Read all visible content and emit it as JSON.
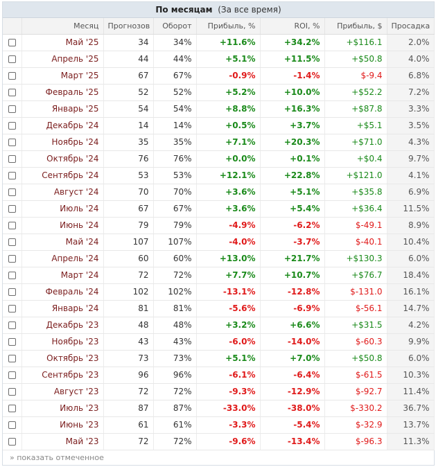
{
  "caption": {
    "title": "По месяцам",
    "subtitle": "(За все время)"
  },
  "columns": [
    "Месяц",
    "Прогнозов",
    "Оборот",
    "Прибыль, %",
    "ROI, %",
    "Прибыль, $",
    "Просадка"
  ],
  "rows": [
    {
      "month": "Май '25",
      "forecasts": "34",
      "turnover": "34%",
      "profit_pct": "+11.6%",
      "roi": "+34.2%",
      "profit_usd": "+$116.1",
      "drawdown": "2.0%"
    },
    {
      "month": "Апрель '25",
      "forecasts": "44",
      "turnover": "44%",
      "profit_pct": "+5.1%",
      "roi": "+11.5%",
      "profit_usd": "+$50.8",
      "drawdown": "4.0%"
    },
    {
      "month": "Март '25",
      "forecasts": "67",
      "turnover": "67%",
      "profit_pct": "-0.9%",
      "roi": "-1.4%",
      "profit_usd": "$-9.4",
      "drawdown": "6.8%"
    },
    {
      "month": "Февраль '25",
      "forecasts": "52",
      "turnover": "52%",
      "profit_pct": "+5.2%",
      "roi": "+10.0%",
      "profit_usd": "+$52.2",
      "drawdown": "7.2%"
    },
    {
      "month": "Январь '25",
      "forecasts": "54",
      "turnover": "54%",
      "profit_pct": "+8.8%",
      "roi": "+16.3%",
      "profit_usd": "+$87.8",
      "drawdown": "3.3%"
    },
    {
      "month": "Декабрь '24",
      "forecasts": "14",
      "turnover": "14%",
      "profit_pct": "+0.5%",
      "roi": "+3.7%",
      "profit_usd": "+$5.1",
      "drawdown": "3.5%"
    },
    {
      "month": "Ноябрь '24",
      "forecasts": "35",
      "turnover": "35%",
      "profit_pct": "+7.1%",
      "roi": "+20.3%",
      "profit_usd": "+$71.0",
      "drawdown": "4.3%"
    },
    {
      "month": "Октябрь '24",
      "forecasts": "76",
      "turnover": "76%",
      "profit_pct": "+0.0%",
      "roi": "+0.1%",
      "profit_usd": "+$0.4",
      "drawdown": "9.7%"
    },
    {
      "month": "Сентябрь '24",
      "forecasts": "53",
      "turnover": "53%",
      "profit_pct": "+12.1%",
      "roi": "+22.8%",
      "profit_usd": "+$121.0",
      "drawdown": "4.1%"
    },
    {
      "month": "Август '24",
      "forecasts": "70",
      "turnover": "70%",
      "profit_pct": "+3.6%",
      "roi": "+5.1%",
      "profit_usd": "+$35.8",
      "drawdown": "6.9%"
    },
    {
      "month": "Июль '24",
      "forecasts": "67",
      "turnover": "67%",
      "profit_pct": "+3.6%",
      "roi": "+5.4%",
      "profit_usd": "+$36.4",
      "drawdown": "11.5%"
    },
    {
      "month": "Июнь '24",
      "forecasts": "79",
      "turnover": "79%",
      "profit_pct": "-4.9%",
      "roi": "-6.2%",
      "profit_usd": "$-49.1",
      "drawdown": "8.9%"
    },
    {
      "month": "Май '24",
      "forecasts": "107",
      "turnover": "107%",
      "profit_pct": "-4.0%",
      "roi": "-3.7%",
      "profit_usd": "$-40.1",
      "drawdown": "10.4%"
    },
    {
      "month": "Апрель '24",
      "forecasts": "60",
      "turnover": "60%",
      "profit_pct": "+13.0%",
      "roi": "+21.7%",
      "profit_usd": "+$130.3",
      "drawdown": "6.0%"
    },
    {
      "month": "Март '24",
      "forecasts": "72",
      "turnover": "72%",
      "profit_pct": "+7.7%",
      "roi": "+10.7%",
      "profit_usd": "+$76.7",
      "drawdown": "18.4%"
    },
    {
      "month": "Февраль '24",
      "forecasts": "102",
      "turnover": "102%",
      "profit_pct": "-13.1%",
      "roi": "-12.8%",
      "profit_usd": "$-131.0",
      "drawdown": "16.1%"
    },
    {
      "month": "Январь '24",
      "forecasts": "81",
      "turnover": "81%",
      "profit_pct": "-5.6%",
      "roi": "-6.9%",
      "profit_usd": "$-56.1",
      "drawdown": "14.7%"
    },
    {
      "month": "Декабрь '23",
      "forecasts": "48",
      "turnover": "48%",
      "profit_pct": "+3.2%",
      "roi": "+6.6%",
      "profit_usd": "+$31.5",
      "drawdown": "4.2%"
    },
    {
      "month": "Ноябрь '23",
      "forecasts": "43",
      "turnover": "43%",
      "profit_pct": "-6.0%",
      "roi": "-14.0%",
      "profit_usd": "$-60.3",
      "drawdown": "9.9%"
    },
    {
      "month": "Октябрь '23",
      "forecasts": "73",
      "turnover": "73%",
      "profit_pct": "+5.1%",
      "roi": "+7.0%",
      "profit_usd": "+$50.8",
      "drawdown": "6.0%"
    },
    {
      "month": "Сентябрь '23",
      "forecasts": "96",
      "turnover": "96%",
      "profit_pct": "-6.1%",
      "roi": "-6.4%",
      "profit_usd": "$-61.5",
      "drawdown": "10.3%"
    },
    {
      "month": "Август '23",
      "forecasts": "72",
      "turnover": "72%",
      "profit_pct": "-9.3%",
      "roi": "-12.9%",
      "profit_usd": "$-92.7",
      "drawdown": "11.4%"
    },
    {
      "month": "Июль '23",
      "forecasts": "87",
      "turnover": "87%",
      "profit_pct": "-33.0%",
      "roi": "-38.0%",
      "profit_usd": "$-330.2",
      "drawdown": "36.7%"
    },
    {
      "month": "Июнь '23",
      "forecasts": "61",
      "turnover": "61%",
      "profit_pct": "-3.3%",
      "roi": "-5.4%",
      "profit_usd": "$-32.9",
      "drawdown": "13.7%"
    },
    {
      "month": "Май '23",
      "forecasts": "72",
      "turnover": "72%",
      "profit_pct": "-9.6%",
      "roi": "-13.4%",
      "profit_usd": "$-96.3",
      "drawdown": "11.3%"
    }
  ],
  "footer": {
    "link": "» показать отмеченное"
  },
  "colors": {
    "positive": "#1a8a1a",
    "negative": "#e01a1a",
    "month": "#7a1c1c",
    "header_bg": "#dfe6ed"
  }
}
